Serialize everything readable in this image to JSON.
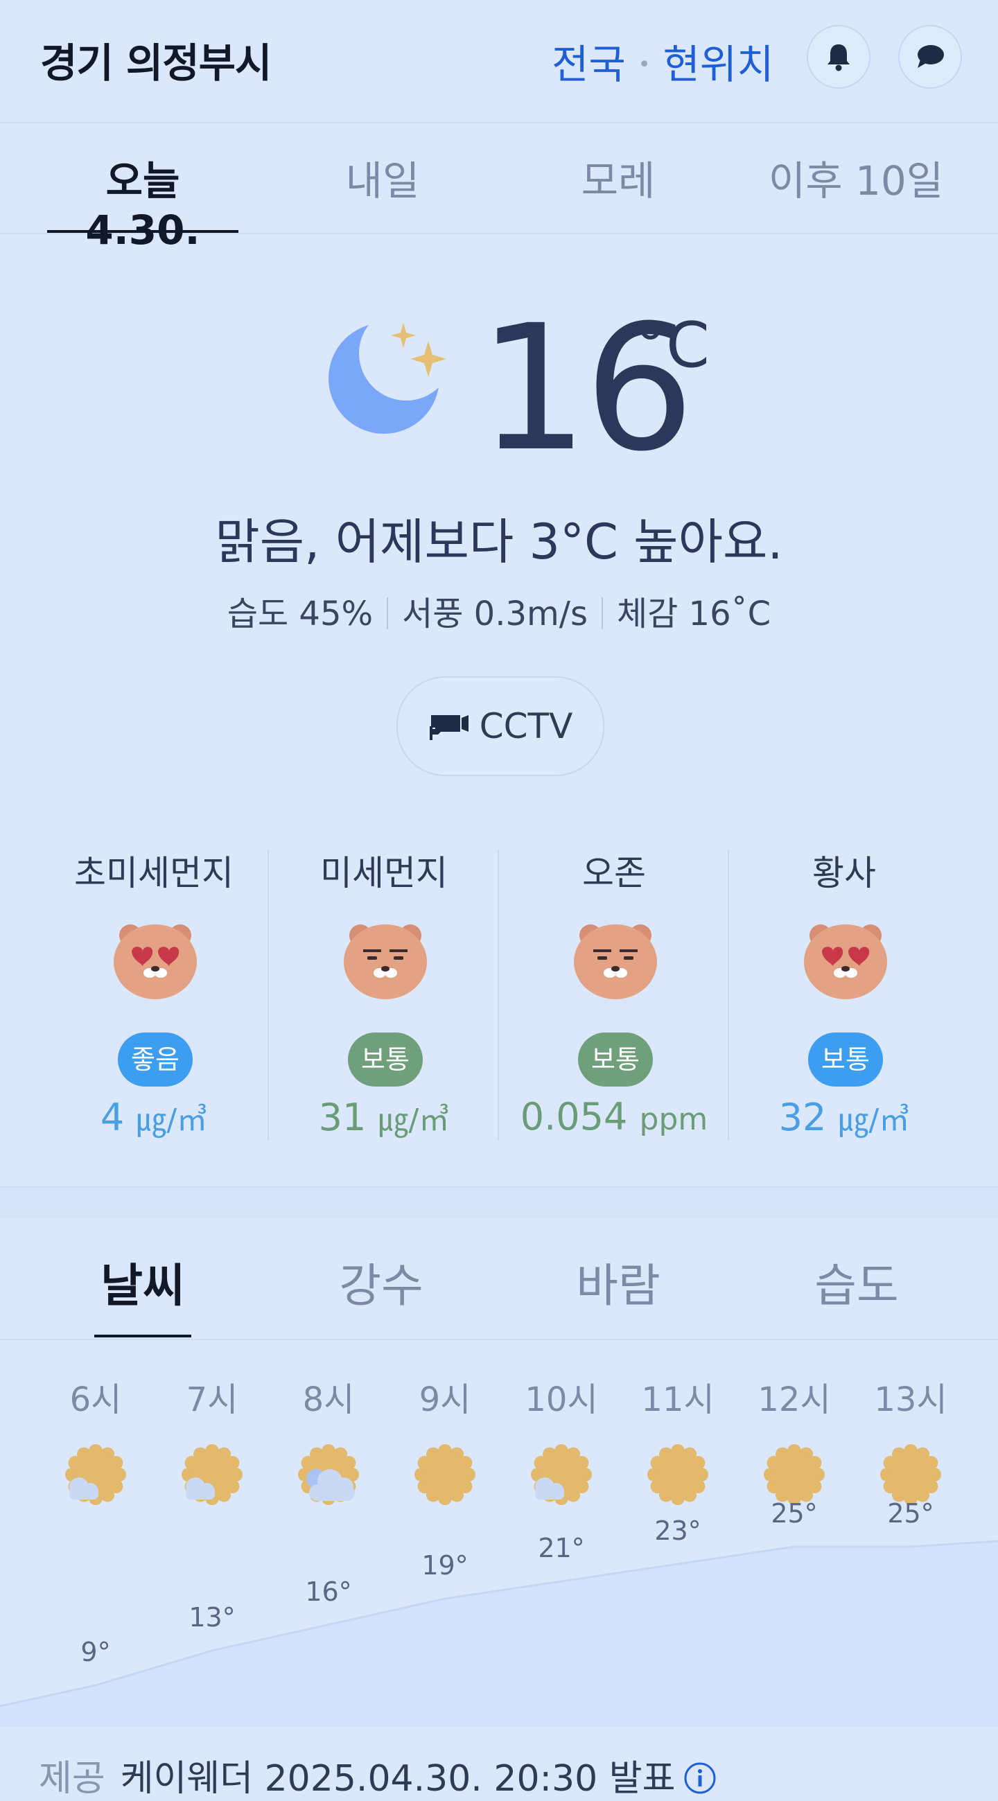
{
  "header": {
    "location": "경기 의정부시",
    "link_national": "전국",
    "link_current": "현위치",
    "bell_icon": "bell-icon",
    "chat_icon": "chat-bubble-icon"
  },
  "day_tabs": [
    {
      "label": "오늘 4.30.",
      "active": true
    },
    {
      "label": "내일",
      "active": false
    },
    {
      "label": "모레",
      "active": false
    },
    {
      "label": "이후 10일",
      "active": false
    }
  ],
  "current": {
    "icon": "clear-night-moon-icon",
    "temperature": "16",
    "unit": "°C",
    "summary": "맑음, 어제보다 3°C 높아요.",
    "humidity": "습도 45%",
    "wind": "서풍 0.3m/s",
    "feels_like": "체감 16˚C",
    "cctv_label": "CCTV"
  },
  "air_quality": [
    {
      "label": "초미세먼지",
      "face": "heart-eyes",
      "status": "좋음",
      "status_color": "#3d9ef0",
      "value": "4",
      "unit": "㎍/㎥",
      "value_color": "#4a9fe3"
    },
    {
      "label": "미세먼지",
      "face": "neutral",
      "status": "보통",
      "status_color": "#6f9f7b",
      "value": "31",
      "unit": "㎍/㎥",
      "value_color": "#6a9d77"
    },
    {
      "label": "오존",
      "face": "neutral",
      "status": "보통",
      "status_color": "#6f9f7b",
      "value": "0.054",
      "unit": "ppm",
      "value_color": "#6a9d77"
    },
    {
      "label": "황사",
      "face": "heart-eyes",
      "status": "보통",
      "status_color": "#3d9ef0",
      "value": "32",
      "unit": "㎍/㎥",
      "value_color": "#4a9fe3"
    }
  ],
  "detail_tabs": [
    {
      "label": "날씨",
      "active": true
    },
    {
      "label": "강수",
      "active": false
    },
    {
      "label": "바람",
      "active": false
    },
    {
      "label": "습도",
      "active": false
    }
  ],
  "hourly": [
    {
      "hour": "6시",
      "icon": "sun-cloud-icon",
      "temp": "9°",
      "t": 9
    },
    {
      "hour": "7시",
      "icon": "sun-cloud-icon",
      "temp": "13°",
      "t": 13
    },
    {
      "hour": "8시",
      "icon": "cloud-sun-icon",
      "temp": "16°",
      "t": 16
    },
    {
      "hour": "9시",
      "icon": "sun-icon",
      "temp": "19°",
      "t": 19
    },
    {
      "hour": "10시",
      "icon": "sun-cloud-icon",
      "temp": "21°",
      "t": 21
    },
    {
      "hour": "11시",
      "icon": "sun-icon",
      "temp": "23°",
      "t": 23
    },
    {
      "hour": "12시",
      "icon": "sun-icon",
      "temp": "25°",
      "t": 25
    },
    {
      "hour": "13시",
      "icon": "sun-icon",
      "temp": "25°",
      "t": 25
    }
  ],
  "footer": {
    "provider_label": "제공",
    "provider_text": "케이웨더 2025.04.30. 20:30 발표",
    "info_icon": "info-icon"
  },
  "colors": {
    "background": "#dbe8fb",
    "accent_link": "#1f5fd6",
    "good": "#3d9ef0",
    "normal": "#6f9f7b",
    "sun": "#e2b96d",
    "moon": "#6f9df7"
  }
}
